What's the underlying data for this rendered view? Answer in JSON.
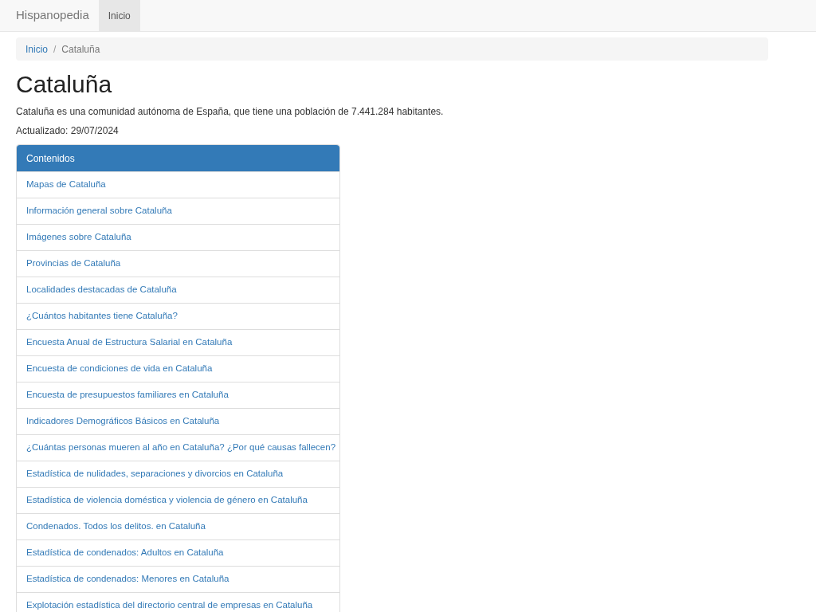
{
  "navbar": {
    "brand": "Hispanopedia",
    "items": [
      {
        "label": "Inicio",
        "selected": true
      }
    ]
  },
  "breadcrumb_separator": "/",
  "breadcrumb": [
    {
      "label": "Inicio",
      "kind": "link"
    },
    {
      "label": "Cataluña",
      "kind": "current"
    }
  ],
  "title": "Cataluña",
  "intro": "Cataluña es una comunidad autónoma de España, que tiene una población de 7.441.284 habitantes.",
  "updated": "Actualizado: 29/07/2024",
  "contents": {
    "heading": "Contenidos",
    "items": [
      "Mapas de Cataluña",
      "Información general sobre Cataluña",
      "Imágenes sobre Cataluña",
      "Provincias de Cataluña",
      "Localidades destacadas de Cataluña",
      "¿Cuántos habitantes tiene Cataluña?",
      "Encuesta Anual de Estructura Salarial en Cataluña",
      "Encuesta de condiciones de vida en Cataluña",
      "Encuesta de presupuestos familiares en Cataluña",
      "Indicadores Demográficos Básicos en Cataluña",
      "¿Cuántas personas mueren al año en Cataluña? ¿Por qué causas fallecen?",
      "Estadística de nulidades, separaciones y divorcios en Cataluña",
      "Estadística de violencia doméstica y violencia de género en Cataluña",
      "Condenados. Todos los delitos. en Cataluña",
      "Estadística de condenados: Adultos en Cataluña",
      "Estadística de condenados: Menores en Cataluña",
      "Explotación estadística del directorio central de empresas en Cataluña"
    ]
  }
}
